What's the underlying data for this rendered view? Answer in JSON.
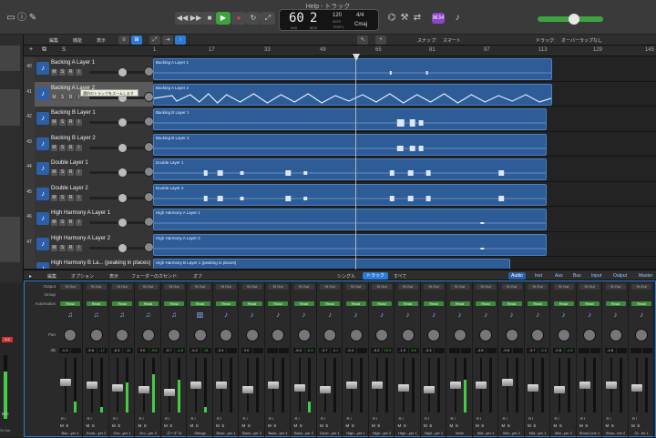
{
  "window_title": "Help - トラック",
  "lcd": {
    "bar": "60",
    "beat": "2",
    "bar_label": "BAR",
    "beat_label": "BEAT",
    "tempo": "120",
    "tempo_label": "KEEP",
    "tempo_sub": "TEMPO",
    "time_sig": "4/4",
    "key": "Cmaj"
  },
  "badge": "⌘34",
  "toolbar2": {
    "edit": "編集",
    "function": "機能",
    "view": "表示",
    "snap_label": "スナップ:",
    "snap_value": "スマート",
    "drag_label": "ドラッグ:",
    "drag_value": "オーバーラップなし"
  },
  "ruler_ticks": [
    "1",
    "17",
    "33",
    "49",
    "65",
    "81",
    "97",
    "113",
    "129",
    "145"
  ],
  "tooltip": "選択のトラックをズームします",
  "tracks": [
    {
      "num": "40",
      "name": "Backing A Layer 1",
      "region": "Backing A Layer 1",
      "msr": [
        "M",
        "S",
        "R",
        "I"
      ]
    },
    {
      "num": "41",
      "name": "Backing A Layer 2",
      "region": "Backing A Layer 2",
      "msr": [
        "M",
        "S",
        "R",
        "I"
      ]
    },
    {
      "num": "42",
      "name": "Backing B Layer 1",
      "region": "Backing B Layer 1",
      "msr": [
        "M",
        "S",
        "R",
        "I"
      ]
    },
    {
      "num": "43",
      "name": "Backing B Layer 2",
      "region": "Backing B Layer 2",
      "msr": [
        "M",
        "S",
        "R",
        "I"
      ]
    },
    {
      "num": "44",
      "name": "Double Layer 1",
      "region": "Double Layer 1",
      "msr": [
        "M",
        "S",
        "R",
        "I"
      ]
    },
    {
      "num": "45",
      "name": "Double Layer 2",
      "region": "Double Layer 2",
      "msr": [
        "M",
        "S",
        "R",
        "I"
      ]
    },
    {
      "num": "46",
      "name": "High Harmony A Layer 1",
      "region": "High Harmony A Layer 1",
      "msr": [
        "M",
        "S",
        "R",
        "I"
      ]
    },
    {
      "num": "47",
      "name": "High Harmony A Layer 2",
      "region": "High Harmony A Layer 2",
      "msr": [
        "M",
        "S",
        "R",
        "I"
      ]
    },
    {
      "num": "",
      "name": "High Harmony B La... (peaking in places)",
      "region": "High Harmony B Layer 1 (peaking in places)",
      "msr": []
    }
  ],
  "mixer_bar": {
    "edit": "編集",
    "options": "オプション",
    "view": "表示",
    "fader_label": "フェーダーのカセンド:",
    "fader_value": "オフ",
    "single": "シングル",
    "tracks": "トラック",
    "all": "すべて",
    "filters": [
      "Audio",
      "Inst",
      "Aux",
      "Bus",
      "Input",
      "Output",
      "Master"
    ]
  },
  "mixer_rows": {
    "output": "Output",
    "group": "Group",
    "automation": "Automation",
    "pan": "Pan",
    "db": "dB"
  },
  "strips": [
    {
      "out": "St Out",
      "db": "-1.3",
      "db2": "",
      "name": "Bac...yer 1",
      "meter": 0.2,
      "fader": 0.55,
      "icon": "guitar-icon"
    },
    {
      "out": "St Out",
      "db": "-5.6",
      "db2": "-17",
      "name": "Doub...yer 2",
      "meter": 0.1,
      "fader": 0.5,
      "icon": "guitar-icon"
    },
    {
      "out": "St Out",
      "db": "-8.3",
      "db2": "-10",
      "name": "Gro...yer 1",
      "meter": 0.55,
      "fader": 0.45,
      "icon": "guitar-icon"
    },
    {
      "out": "St Out",
      "db": "0.0",
      "db2": "-9.8",
      "name": "Gro...yer 2",
      "meter": 0.7,
      "fader": 0.4,
      "icon": "guitar-icon"
    },
    {
      "out": "St Out",
      "db": "-3.7",
      "db2": "-4.6",
      "name": "ゴーデ 11",
      "meter": 0.6,
      "fader": 0.35,
      "icon": "guitar-icon"
    },
    {
      "out": "St Out",
      "db": "-6.2",
      "db2": "-21",
      "name": "Strings",
      "meter": 0.1,
      "fader": 0.5,
      "icon": "meter-icon"
    },
    {
      "out": "St Out",
      "db": "-3.4",
      "db2": "",
      "name": "Back...yer 1",
      "meter": 0,
      "fader": 0.5,
      "icon": "mic-icon"
    },
    {
      "out": "St Out",
      "db": "0.0",
      "db2": "",
      "name": "Back...yer 2",
      "meter": 0,
      "fader": 0.4,
      "icon": "mic-icon"
    },
    {
      "out": "St Out",
      "db": "",
      "db2": "",
      "name": "Back...yer 1",
      "meter": 0,
      "fader": 0.5,
      "icon": "mic-icon"
    },
    {
      "out": "St Out",
      "db": "-6.0",
      "db2": "-6.3",
      "name": "Back...yer 2",
      "meter": 0.2,
      "fader": 0.45,
      "icon": "mic-icon"
    },
    {
      "out": "St Out",
      "db": "-3.7",
      "db2": "8.1",
      "name": "Doub...yer 1",
      "meter": 0,
      "fader": 0.4,
      "icon": "mic-icon"
    },
    {
      "out": "St Out",
      "db": "-5.4",
      "db2": "",
      "name": "High...yer 1",
      "meter": 0,
      "fader": 0.5,
      "icon": "mic-icon"
    },
    {
      "out": "St Out",
      "db": "-5.2",
      "db2": "19.0",
      "name": "High...yer 2",
      "meter": 0,
      "fader": 0.5,
      "icon": "mic-icon"
    },
    {
      "out": "St Out",
      "db": "-1.9",
      "db2": "9.8",
      "name": "High...yer 1",
      "meter": 0,
      "fader": 0.45,
      "icon": "mic-icon"
    },
    {
      "out": "St Out",
      "db": "-3.3",
      "db2": "",
      "name": "High...yer 2",
      "meter": 0,
      "fader": 0.4,
      "icon": "mic-icon"
    },
    {
      "out": "St Out",
      "db": "",
      "db2": "",
      "name": "Main",
      "meter": 0.6,
      "fader": 0.5,
      "icon": "mic-icon"
    },
    {
      "out": "St Out",
      "db": "-4.8",
      "db2": "",
      "name": "Mid...yer 1",
      "meter": 0,
      "fader": 0.5,
      "icon": "mic-icon"
    },
    {
      "out": "St Out",
      "db": "-9.8",
      "db2": "",
      "name": "Mid...yer 2",
      "meter": 0,
      "fader": 0.55,
      "icon": "mic-icon"
    },
    {
      "out": "St Out",
      "db": "-3.7",
      "db2": "-5.6",
      "name": "Mid...yer 1",
      "meter": 0,
      "fader": 0.45,
      "icon": "mic-icon"
    },
    {
      "out": "St Out",
      "db": "-2.8",
      "db2": "-1.5",
      "name": "Mid...yer 2",
      "meter": 0,
      "fader": 0.4,
      "icon": "mic-icon"
    },
    {
      "out": "St Out",
      "db": "",
      "db2": "",
      "name": "Shout Line 1",
      "meter": 0,
      "fader": 0.5,
      "icon": "mic-icon"
    },
    {
      "out": "St Out",
      "db": "-4.8",
      "db2": "",
      "name": "Shou...ine 2",
      "meter": 0,
      "fader": 0.5,
      "icon": "mic-icon"
    },
    {
      "out": "St Out",
      "db": "",
      "db2": "",
      "name": "Gr...ler 1",
      "meter": 0,
      "fader": 0.45,
      "icon": "mic-icon"
    }
  ],
  "left_mixer": {
    "db": "8.6",
    "label": "Bnc",
    "out": "St Out"
  }
}
